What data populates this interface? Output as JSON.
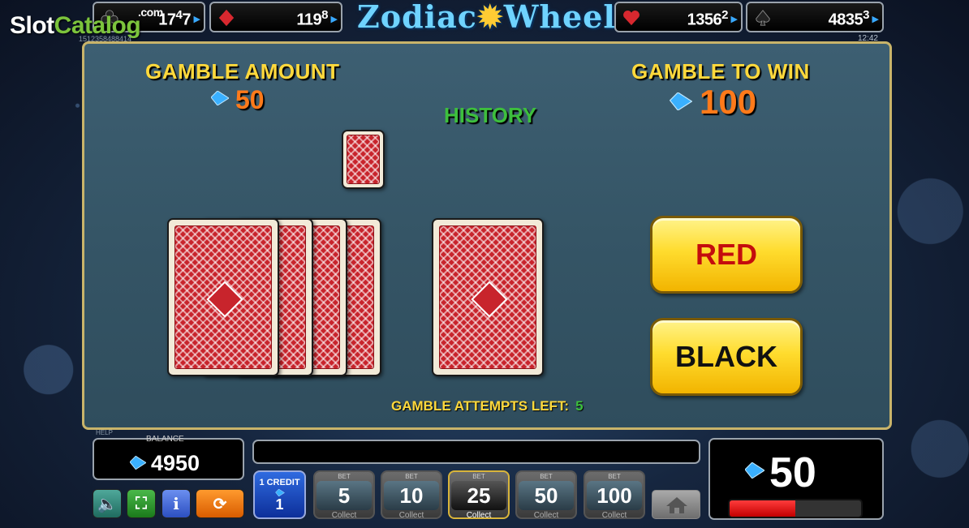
{
  "brand": {
    "part1": "Slot",
    "part2": "Catalog",
    "suffix": ".com"
  },
  "game_title": {
    "pre": "Zodiac",
    "post": "Wheel"
  },
  "jackpots": [
    {
      "suit": "club-icon",
      "value": "17",
      "sup": "4",
      "tail": "7"
    },
    {
      "suit": "diamond-icon",
      "value": "119",
      "sup": "8"
    },
    {
      "suit": "heart-icon",
      "value": "1356",
      "sup": "2"
    },
    {
      "suit": "spade-icon",
      "value": "4835",
      "sup": "3"
    }
  ],
  "ticket_id": "1512358488414",
  "clock": "12:42",
  "gamble": {
    "amount_label": "GAMBLE AMOUNT",
    "amount_value": "50",
    "to_win_label": "GAMBLE TO WIN",
    "to_win_value": "100",
    "history_label": "HISTORY",
    "attempts_label": "GAMBLE ATTEMPTS LEFT:",
    "attempts_value": "5",
    "red_label": "RED",
    "black_label": "BLACK"
  },
  "balance": {
    "label": "BALANCE",
    "value": "4950"
  },
  "win": {
    "value": "50",
    "progress_fraction": 0.5
  },
  "credit": {
    "label": "1 CREDIT",
    "value": "1"
  },
  "bets": [
    {
      "label": "BET",
      "value": "5",
      "collect": "Collect",
      "selected": false
    },
    {
      "label": "BET",
      "value": "10",
      "collect": "Collect",
      "selected": false
    },
    {
      "label": "BET",
      "value": "25",
      "collect": "Collect",
      "selected": true
    },
    {
      "label": "BET",
      "value": "50",
      "collect": "Collect",
      "selected": false
    },
    {
      "label": "BET",
      "value": "100",
      "collect": "Collect",
      "selected": false
    }
  ],
  "controls": {
    "help_label": "HELP",
    "info_label": "i"
  },
  "colors": {
    "gold": "#ffd93c",
    "orange": "#ff7a1a",
    "green": "#3dbf3d",
    "red_btn_text": "#c40d0d",
    "black_btn_text": "#111111"
  }
}
